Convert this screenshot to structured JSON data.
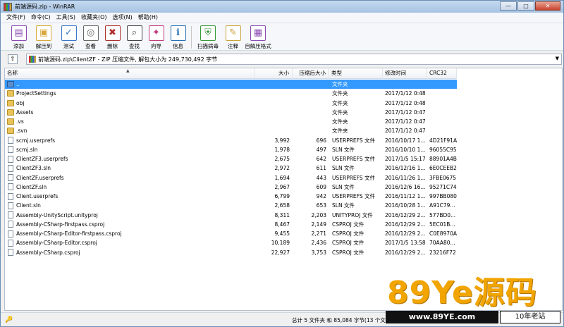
{
  "window": {
    "title": "前端源码.zip - WinRAR",
    "controls": [
      "—",
      "□",
      "✕"
    ]
  },
  "menu": [
    "文件(F)",
    "命令(C)",
    "工具(S)",
    "收藏夹(O)",
    "选项(N)",
    "帮助(H)"
  ],
  "toolbar": [
    {
      "label": "添加",
      "icon": "add-archive-icon",
      "color": "#8a4bb3",
      "glyph": "▤"
    },
    {
      "label": "解压到",
      "icon": "extract-to-icon",
      "color": "#d9a73a",
      "glyph": "▣"
    },
    {
      "label": "测试",
      "icon": "test-icon",
      "color": "#3a77c9",
      "glyph": "✓"
    },
    {
      "label": "查看",
      "icon": "view-icon",
      "color": "#666666",
      "glyph": "◎"
    },
    {
      "label": "删除",
      "icon": "delete-icon",
      "color": "#b03030",
      "glyph": "✖"
    },
    {
      "label": "查找",
      "icon": "find-icon",
      "color": "#444444",
      "glyph": "⌕"
    },
    {
      "label": "向导",
      "icon": "wizard-icon",
      "color": "#c03a7a",
      "glyph": "✦"
    },
    {
      "label": "信息",
      "icon": "info-icon",
      "color": "#2a6fb5",
      "glyph": "ℹ"
    },
    {
      "label": "扫描病毒",
      "icon": "virus-scan-icon",
      "color": "#3a9a3a",
      "glyph": "⛨"
    },
    {
      "label": "注释",
      "icon": "comment-icon",
      "color": "#c9a23a",
      "glyph": "✎"
    },
    {
      "label": "自解压格式",
      "icon": "sfx-icon",
      "color": "#8a4bb3",
      "glyph": "▦"
    }
  ],
  "address": {
    "text": "前端源码.zip\\ClientZF - ZIP 压缩文件, 解包大小为 249,730,492 字节"
  },
  "columns": {
    "name": "名称",
    "size": "大小",
    "packed": "压缩后大小",
    "type": "类型",
    "modified": "修改时间",
    "crc": "CRC32"
  },
  "files": [
    {
      "name": "..",
      "size": "",
      "packed": "",
      "type": "文件夹",
      "modified": "",
      "crc": "",
      "kind": "up",
      "selected": true
    },
    {
      "name": "ProjectSettings",
      "size": "",
      "packed": "",
      "type": "文件夹",
      "modified": "2017/1/12 0:48",
      "crc": "",
      "kind": "folder"
    },
    {
      "name": "obj",
      "size": "",
      "packed": "",
      "type": "文件夹",
      "modified": "2017/1/12 0:48",
      "crc": "",
      "kind": "folder"
    },
    {
      "name": "Assets",
      "size": "",
      "packed": "",
      "type": "文件夹",
      "modified": "2017/1/12 0:47",
      "crc": "",
      "kind": "folder"
    },
    {
      "name": ".vs",
      "size": "",
      "packed": "",
      "type": "文件夹",
      "modified": "2017/1/12 0:47",
      "crc": "",
      "kind": "folder"
    },
    {
      "name": ".svn",
      "size": "",
      "packed": "",
      "type": "文件夹",
      "modified": "2017/1/12 0:47",
      "crc": "",
      "kind": "folder"
    },
    {
      "name": "scmj.userprefs",
      "size": "3,992",
      "packed": "696",
      "type": "USERPREFS 文件",
      "modified": "2016/10/17 1...",
      "crc": "4D21F91A",
      "kind": "file"
    },
    {
      "name": "scmj.sln",
      "size": "1,978",
      "packed": "497",
      "type": "SLN 文件",
      "modified": "2016/10/10 1...",
      "crc": "96055C95",
      "kind": "file"
    },
    {
      "name": "ClientZF3.userprefs",
      "size": "2,675",
      "packed": "642",
      "type": "USERPREFS 文件",
      "modified": "2017/1/5 15:17",
      "crc": "88901A4B",
      "kind": "file"
    },
    {
      "name": "ClientZF3.sln",
      "size": "2,972",
      "packed": "611",
      "type": "SLN 文件",
      "modified": "2016/12/16 1...",
      "crc": "6E0CEEB2",
      "kind": "file"
    },
    {
      "name": "ClientZF.userprefs",
      "size": "1,694",
      "packed": "443",
      "type": "USERPREFS 文件",
      "modified": "2016/11/26 1...",
      "crc": "3FBE0675",
      "kind": "file"
    },
    {
      "name": "ClientZF.sln",
      "size": "2,967",
      "packed": "609",
      "type": "SLN 文件",
      "modified": "2016/12/6 16...",
      "crc": "95271C74",
      "kind": "file"
    },
    {
      "name": "Client.userprefs",
      "size": "6,799",
      "packed": "942",
      "type": "USERPREFS 文件",
      "modified": "2016/11/12 1...",
      "crc": "997BB080",
      "kind": "file"
    },
    {
      "name": "Client.sln",
      "size": "2,658",
      "packed": "653",
      "type": "SLN 文件",
      "modified": "2016/10/28 1...",
      "crc": "A91C79...",
      "kind": "file"
    },
    {
      "name": "Assembly-UnityScript.unityproj",
      "size": "8,311",
      "packed": "2,203",
      "type": "UNITYPROJ 文件",
      "modified": "2016/12/29 2...",
      "crc": "577BD0...",
      "kind": "file"
    },
    {
      "name": "Assembly-CSharp-firstpass.csproj",
      "size": "8,467",
      "packed": "2,149",
      "type": "CSPROJ 文件",
      "modified": "2016/12/29 2...",
      "crc": "5EC01B...",
      "kind": "file"
    },
    {
      "name": "Assembly-CSharp-Editor-firstpass.csproj",
      "size": "9,455",
      "packed": "2,271",
      "type": "CSPROJ 文件",
      "modified": "2016/12/29 2...",
      "crc": "C0E8970A",
      "kind": "file"
    },
    {
      "name": "Assembly-CSharp-Editor.csproj",
      "size": "10,189",
      "packed": "2,436",
      "type": "CSPROJ 文件",
      "modified": "2017/1/5 13:58",
      "crc": "70AA80...",
      "kind": "file"
    },
    {
      "name": "Assembly-CSharp.csproj",
      "size": "22,927",
      "packed": "3,753",
      "type": "CSPROJ 文件",
      "modified": "2016/12/29 2...",
      "crc": "23216F72",
      "kind": "file"
    }
  ],
  "status": {
    "text": "总计 5 文件夹 和 85,084 字节(13 个文件)"
  },
  "watermark": {
    "brand": "89Ye源码",
    "url": "www.89YE.com",
    "tag": "10年老站"
  }
}
